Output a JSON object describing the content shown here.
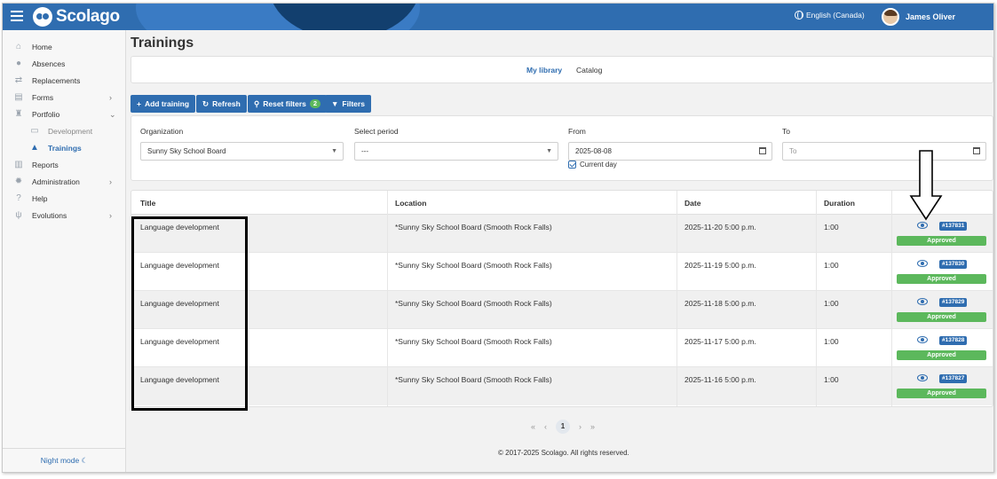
{
  "app": {
    "logo_text": "Scolago",
    "language": "English (Canada)",
    "user_name": "James Oliver"
  },
  "sidebar": {
    "items": [
      {
        "label": "Home",
        "icon": "home-icon"
      },
      {
        "label": "Absences",
        "icon": "person-clock-icon"
      },
      {
        "label": "Replacements",
        "icon": "swap-icon"
      },
      {
        "label": "Forms",
        "icon": "document-icon",
        "chevron": "›"
      },
      {
        "label": "Portfolio",
        "icon": "trophy-icon",
        "chevron": "⌄"
      },
      {
        "label": "Development",
        "icon": "certificate-icon"
      },
      {
        "label": "Trainings",
        "icon": "graduation-cap-icon"
      },
      {
        "label": "Reports",
        "icon": "report-icon"
      },
      {
        "label": "Administration",
        "icon": "gear-icon",
        "chevron": "›"
      },
      {
        "label": "Help",
        "icon": "question-icon"
      },
      {
        "label": "Evolutions",
        "icon": "sprout-icon",
        "chevron": "›"
      }
    ],
    "night_mode": "Night mode"
  },
  "page": {
    "title": "Trainings"
  },
  "tabs": {
    "my_library": "My library",
    "catalog": "Catalog"
  },
  "toolbar": {
    "add_training": "Add training",
    "refresh": "Refresh",
    "reset_filters": "Reset filters",
    "reset_filters_count": "2",
    "filters": "Filters"
  },
  "filters": {
    "organization_label": "Organization",
    "organization_value": "Sunny Sky School Board",
    "period_label": "Select period",
    "period_value": "---",
    "from_label": "From",
    "from_value": "2025-08-08",
    "current_day_label": "Current day",
    "to_label": "To",
    "to_placeholder": "To"
  },
  "table": {
    "headers": {
      "title": "Title",
      "location": "Location",
      "date": "Date",
      "duration": "Duration"
    },
    "rows": [
      {
        "title": "Language development",
        "location": "*Sunny Sky School Board (Smooth Rock Falls)",
        "date": "2025-11-20 5:00 p.m.",
        "duration": "1:00",
        "id": "#137831",
        "status": "Approved"
      },
      {
        "title": "Language development",
        "location": "*Sunny Sky School Board (Smooth Rock Falls)",
        "date": "2025-11-19 5:00 p.m.",
        "duration": "1:00",
        "id": "#137830",
        "status": "Approved"
      },
      {
        "title": "Language development",
        "location": "*Sunny Sky School Board (Smooth Rock Falls)",
        "date": "2025-11-18 5:00 p.m.",
        "duration": "1:00",
        "id": "#137829",
        "status": "Approved"
      },
      {
        "title": "Language development",
        "location": "*Sunny Sky School Board (Smooth Rock Falls)",
        "date": "2025-11-17 5:00 p.m.",
        "duration": "1:00",
        "id": "#137828",
        "status": "Approved"
      },
      {
        "title": "Language development",
        "location": "*Sunny Sky School Board (Smooth Rock Falls)",
        "date": "2025-11-16 5:00 p.m.",
        "duration": "1:00",
        "id": "#137827",
        "status": "Approved"
      }
    ]
  },
  "pagination": {
    "current": "1"
  },
  "footer": {
    "copyright": "© 2017-2025 Scolago. All rights reserved."
  },
  "colors": {
    "primary": "#2f6db0",
    "approved": "#5cb85c"
  }
}
